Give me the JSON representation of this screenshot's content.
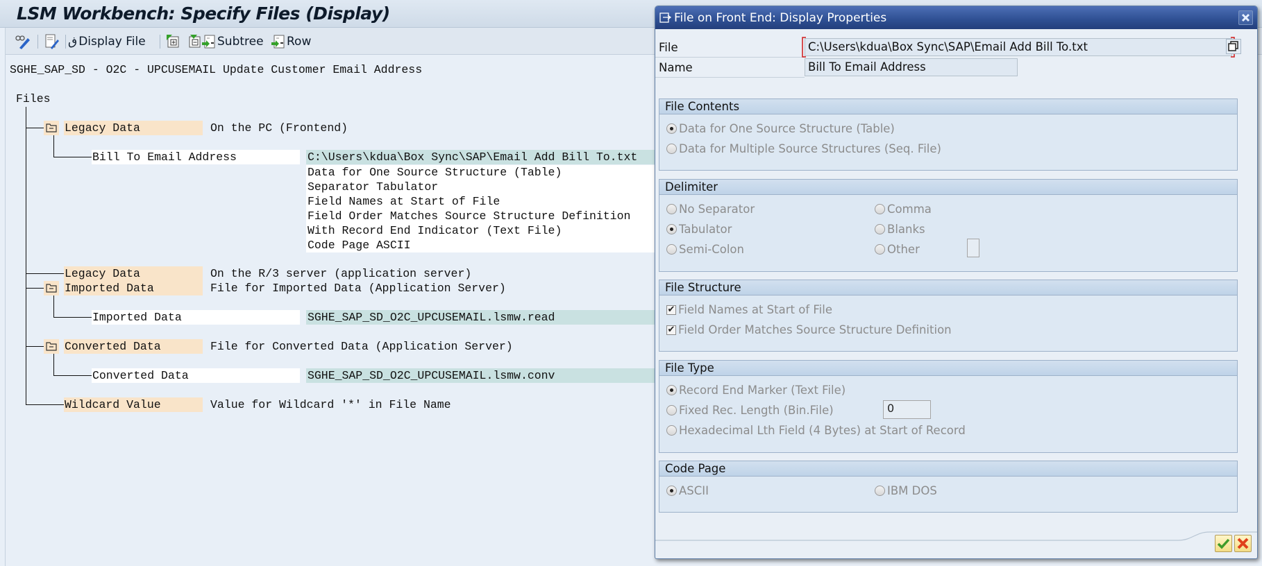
{
  "app": {
    "title": "LSM Workbench: Specify Files (Display)"
  },
  "toolbar": {
    "items": [
      {
        "icon": "display-change-icon",
        "label": ""
      },
      {
        "icon": "edit-document-icon",
        "label": ""
      },
      {
        "icon": "glasses-icon",
        "label": "Display File"
      },
      {
        "icon": "expand-all-icon",
        "label": ""
      },
      {
        "icon": "collapse-all-icon",
        "label": ""
      },
      {
        "icon": "insert-subtree-icon",
        "label": "Subtree"
      },
      {
        "icon": "insert-row-icon",
        "label": "Row"
      }
    ]
  },
  "subtitle": "SGHE_SAP_SD - O2C - UPCUSEMAIL Update Customer Email Address",
  "tree": {
    "root": "Files",
    "nodes": [
      {
        "label": "Legacy Data",
        "desc": "On the PC (Frontend)",
        "folder": true,
        "child": {
          "label": "Bill To Email Address",
          "values": [
            "C:\\Users\\kdua\\Box Sync\\SAP\\Email Add Bill To.txt",
            "Data for One Source Structure (Table)",
            "Separator Tabulator",
            "Field Names at Start of File",
            "Field Order Matches Source Structure Definition",
            "With Record End Indicator (Text File)",
            "Code Page ASCII"
          ]
        }
      },
      {
        "label": "Legacy Data",
        "desc": "On the R/3 server (application server)",
        "folder": false
      },
      {
        "label": "Imported Data",
        "desc": "File for Imported Data (Application Server)",
        "folder": true,
        "child": {
          "label": "Imported Data",
          "values": [
            "SGHE_SAP_SD_O2C_UPCUSEMAIL.lsmw.read"
          ]
        }
      },
      {
        "label": "Converted Data",
        "desc": "File for Converted Data (Application Server)",
        "folder": true,
        "child": {
          "label": "Converted Data",
          "values": [
            "SGHE_SAP_SD_O2C_UPCUSEMAIL.lsmw.conv"
          ]
        }
      },
      {
        "label": "Wildcard Value",
        "desc": "Value for Wildcard '*' in File Name",
        "folder": false
      }
    ]
  },
  "dialog": {
    "title": "File on Front End: Display Properties",
    "file_label": "File",
    "file_value": "C:\\Users\\kdua\\Box Sync\\SAP\\Email Add Bill To.txt",
    "name_label": "Name",
    "name_value": "Bill To Email Address",
    "file_contents": {
      "title": "File Contents",
      "options": [
        {
          "label": "Data for One Source Structure (Table)",
          "selected": true
        },
        {
          "label": "Data for Multiple Source Structures (Seq. File)",
          "selected": false
        }
      ]
    },
    "delimiter": {
      "title": "Delimiter",
      "options": [
        {
          "label": "No Separator",
          "selected": false
        },
        {
          "label": "Tabulator",
          "selected": true
        },
        {
          "label": "Semi-Colon",
          "selected": false
        },
        {
          "label": "Comma",
          "selected": false
        },
        {
          "label": "Blanks",
          "selected": false
        },
        {
          "label": "Other",
          "selected": false
        }
      ],
      "other_value": ""
    },
    "file_structure": {
      "title": "File Structure",
      "options": [
        {
          "label": "Field Names at Start of File",
          "checked": true
        },
        {
          "label": "Field Order Matches Source Structure Definition",
          "checked": true
        }
      ]
    },
    "file_type": {
      "title": "File Type",
      "options": [
        {
          "label": "Record End Marker (Text File)",
          "selected": true
        },
        {
          "label": "Fixed Rec. Length (Bin.File)",
          "selected": false
        },
        {
          "label": "Hexadecimal Lth Field (4 Bytes) at Start of Record",
          "selected": false
        }
      ],
      "fixed_length_value": "0"
    },
    "code_page": {
      "title": "Code Page",
      "options": [
        {
          "label": "ASCII",
          "selected": true
        },
        {
          "label": "IBM DOS",
          "selected": false
        }
      ]
    },
    "ok_icon": "checkmark-icon",
    "cancel_icon": "cancel-icon",
    "colors": {
      "title_bar": "#2e4f92",
      "highlight": "#f9e4c9",
      "value_bg": "#c9e1e1"
    }
  }
}
